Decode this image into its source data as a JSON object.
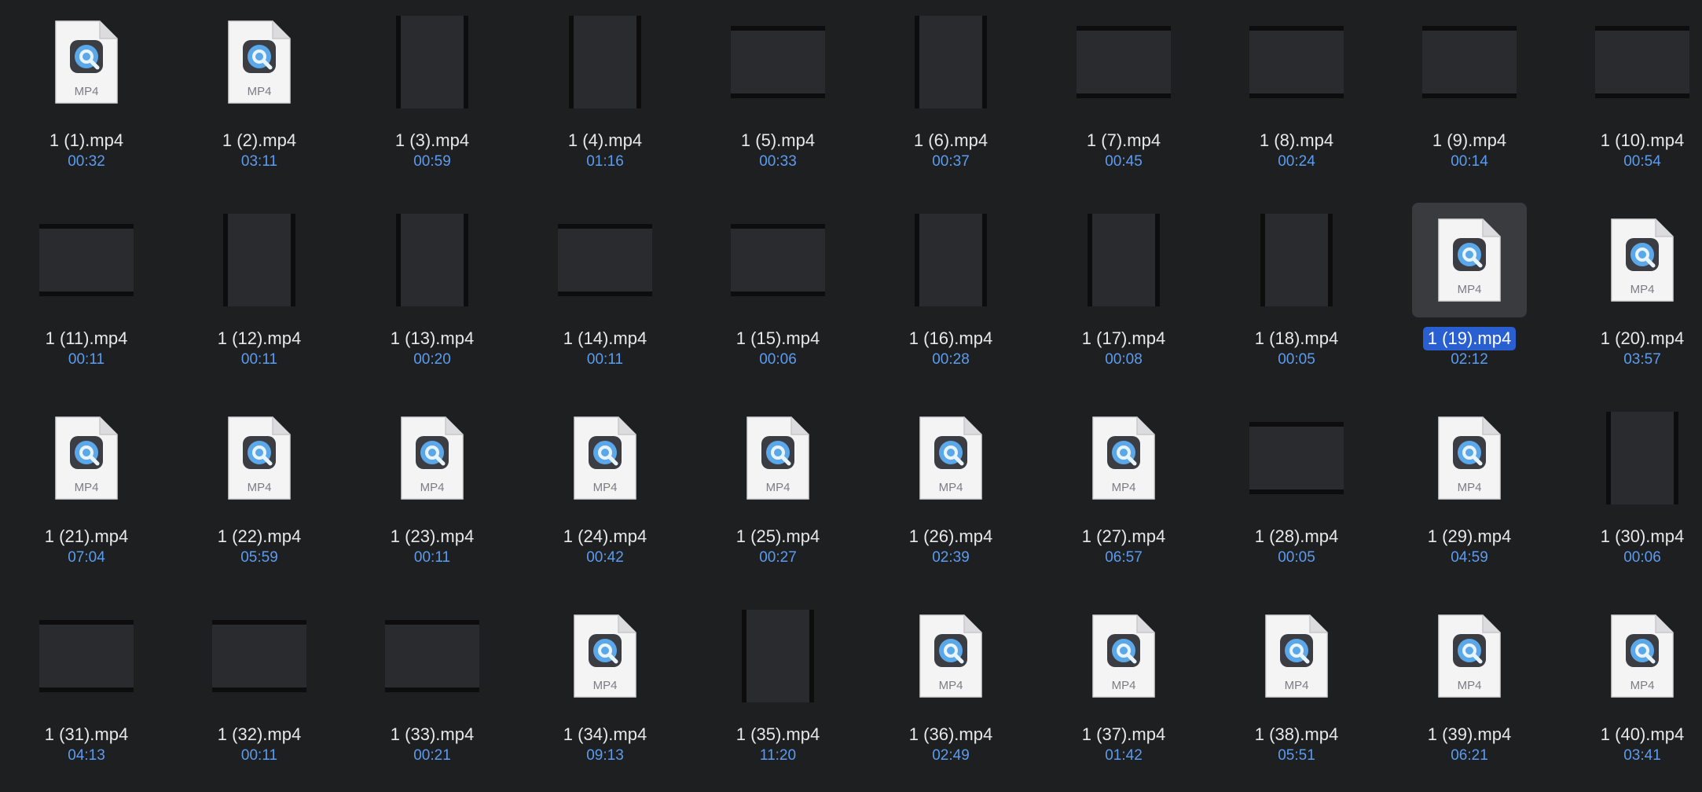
{
  "window": {
    "title": ""
  },
  "files": [
    {
      "name": "1 (1).mp4",
      "duration": "00:32",
      "icon": "mp4-document-icon",
      "thumb": "doc"
    },
    {
      "name": "1 (2).mp4",
      "duration": "03:11",
      "icon": "mp4-document-icon",
      "thumb": "doc"
    },
    {
      "name": "1 (3).mp4",
      "duration": "00:59",
      "icon": "video-thumbnail",
      "thumb": "port"
    },
    {
      "name": "1 (4).mp4",
      "duration": "01:16",
      "icon": "video-thumbnail",
      "thumb": "port"
    },
    {
      "name": "1 (5).mp4",
      "duration": "00:33",
      "icon": "video-thumbnail",
      "thumb": "land"
    },
    {
      "name": "1 (6).mp4",
      "duration": "00:37",
      "icon": "video-thumbnail",
      "thumb": "port"
    },
    {
      "name": "1 (7).mp4",
      "duration": "00:45",
      "icon": "video-thumbnail",
      "thumb": "land"
    },
    {
      "name": "1 (8).mp4",
      "duration": "00:24",
      "icon": "video-thumbnail",
      "thumb": "land"
    },
    {
      "name": "1 (9).mp4",
      "duration": "00:14",
      "icon": "video-thumbnail",
      "thumb": "land"
    },
    {
      "name": "1 (10).mp4",
      "duration": "00:54",
      "icon": "video-thumbnail",
      "thumb": "land"
    },
    {
      "name": "1 (11).mp4",
      "duration": "00:11",
      "icon": "video-thumbnail",
      "thumb": "land"
    },
    {
      "name": "1 (12).mp4",
      "duration": "00:11",
      "icon": "video-thumbnail",
      "thumb": "port"
    },
    {
      "name": "1 (13).mp4",
      "duration": "00:20",
      "icon": "video-thumbnail",
      "thumb": "port"
    },
    {
      "name": "1 (14).mp4",
      "duration": "00:11",
      "icon": "video-thumbnail",
      "thumb": "land"
    },
    {
      "name": "1 (15).mp4",
      "duration": "00:06",
      "icon": "video-thumbnail",
      "thumb": "land"
    },
    {
      "name": "1 (16).mp4",
      "duration": "00:28",
      "icon": "video-thumbnail",
      "thumb": "port"
    },
    {
      "name": "1 (17).mp4",
      "duration": "00:08",
      "icon": "video-thumbnail",
      "thumb": "port"
    },
    {
      "name": "1 (18).mp4",
      "duration": "00:05",
      "icon": "video-thumbnail",
      "thumb": "port"
    },
    {
      "name": "1 (19).mp4",
      "duration": "02:12",
      "icon": "mp4-document-icon",
      "thumb": "doc",
      "selected": true
    },
    {
      "name": "1 (20).mp4",
      "duration": "03:57",
      "icon": "mp4-document-icon",
      "thumb": "doc"
    },
    {
      "name": "1 (21).mp4",
      "duration": "07:04",
      "icon": "mp4-document-icon",
      "thumb": "doc"
    },
    {
      "name": "1 (22).mp4",
      "duration": "05:59",
      "icon": "mp4-document-icon",
      "thumb": "doc"
    },
    {
      "name": "1 (23).mp4",
      "duration": "00:11",
      "icon": "mp4-document-icon",
      "thumb": "doc"
    },
    {
      "name": "1 (24).mp4",
      "duration": "00:42",
      "icon": "mp4-document-icon",
      "thumb": "doc"
    },
    {
      "name": "1 (25).mp4",
      "duration": "00:27",
      "icon": "mp4-document-icon",
      "thumb": "doc"
    },
    {
      "name": "1 (26).mp4",
      "duration": "02:39",
      "icon": "mp4-document-icon",
      "thumb": "doc"
    },
    {
      "name": "1 (27).mp4",
      "duration": "06:57",
      "icon": "mp4-document-icon",
      "thumb": "doc"
    },
    {
      "name": "1 (28).mp4",
      "duration": "00:05",
      "icon": "video-thumbnail",
      "thumb": "land"
    },
    {
      "name": "1 (29).mp4",
      "duration": "04:59",
      "icon": "mp4-document-icon",
      "thumb": "doc"
    },
    {
      "name": "1 (30).mp4",
      "duration": "00:06",
      "icon": "video-thumbnail",
      "thumb": "port"
    },
    {
      "name": "1 (31).mp4",
      "duration": "04:13",
      "icon": "video-thumbnail",
      "thumb": "land"
    },
    {
      "name": "1 (32).mp4",
      "duration": "00:11",
      "icon": "video-thumbnail",
      "thumb": "land"
    },
    {
      "name": "1 (33).mp4",
      "duration": "00:21",
      "icon": "video-thumbnail",
      "thumb": "land"
    },
    {
      "name": "1 (34).mp4",
      "duration": "09:13",
      "icon": "mp4-document-icon",
      "thumb": "doc"
    },
    {
      "name": "1 (35).mp4",
      "duration": "11:20",
      "icon": "video-thumbnail",
      "thumb": "port"
    },
    {
      "name": "1 (36).mp4",
      "duration": "02:49",
      "icon": "mp4-document-icon",
      "thumb": "doc"
    },
    {
      "name": "1 (37).mp4",
      "duration": "01:42",
      "icon": "mp4-document-icon",
      "thumb": "doc"
    },
    {
      "name": "1 (38).mp4",
      "duration": "05:51",
      "icon": "mp4-document-icon",
      "thumb": "doc"
    },
    {
      "name": "1 (39).mp4",
      "duration": "06:21",
      "icon": "mp4-document-icon",
      "thumb": "doc"
    },
    {
      "name": "1 (40).mp4",
      "duration": "03:41",
      "icon": "mp4-document-icon",
      "thumb": "doc"
    }
  ],
  "doc_icon_label": "MP4",
  "colors": {
    "background": "#1e1f21",
    "filename": "#e8e8ea",
    "duration": "#5b9cf0",
    "selection": "#2a5fd1",
    "selection_tile": "#3a3b3e"
  }
}
